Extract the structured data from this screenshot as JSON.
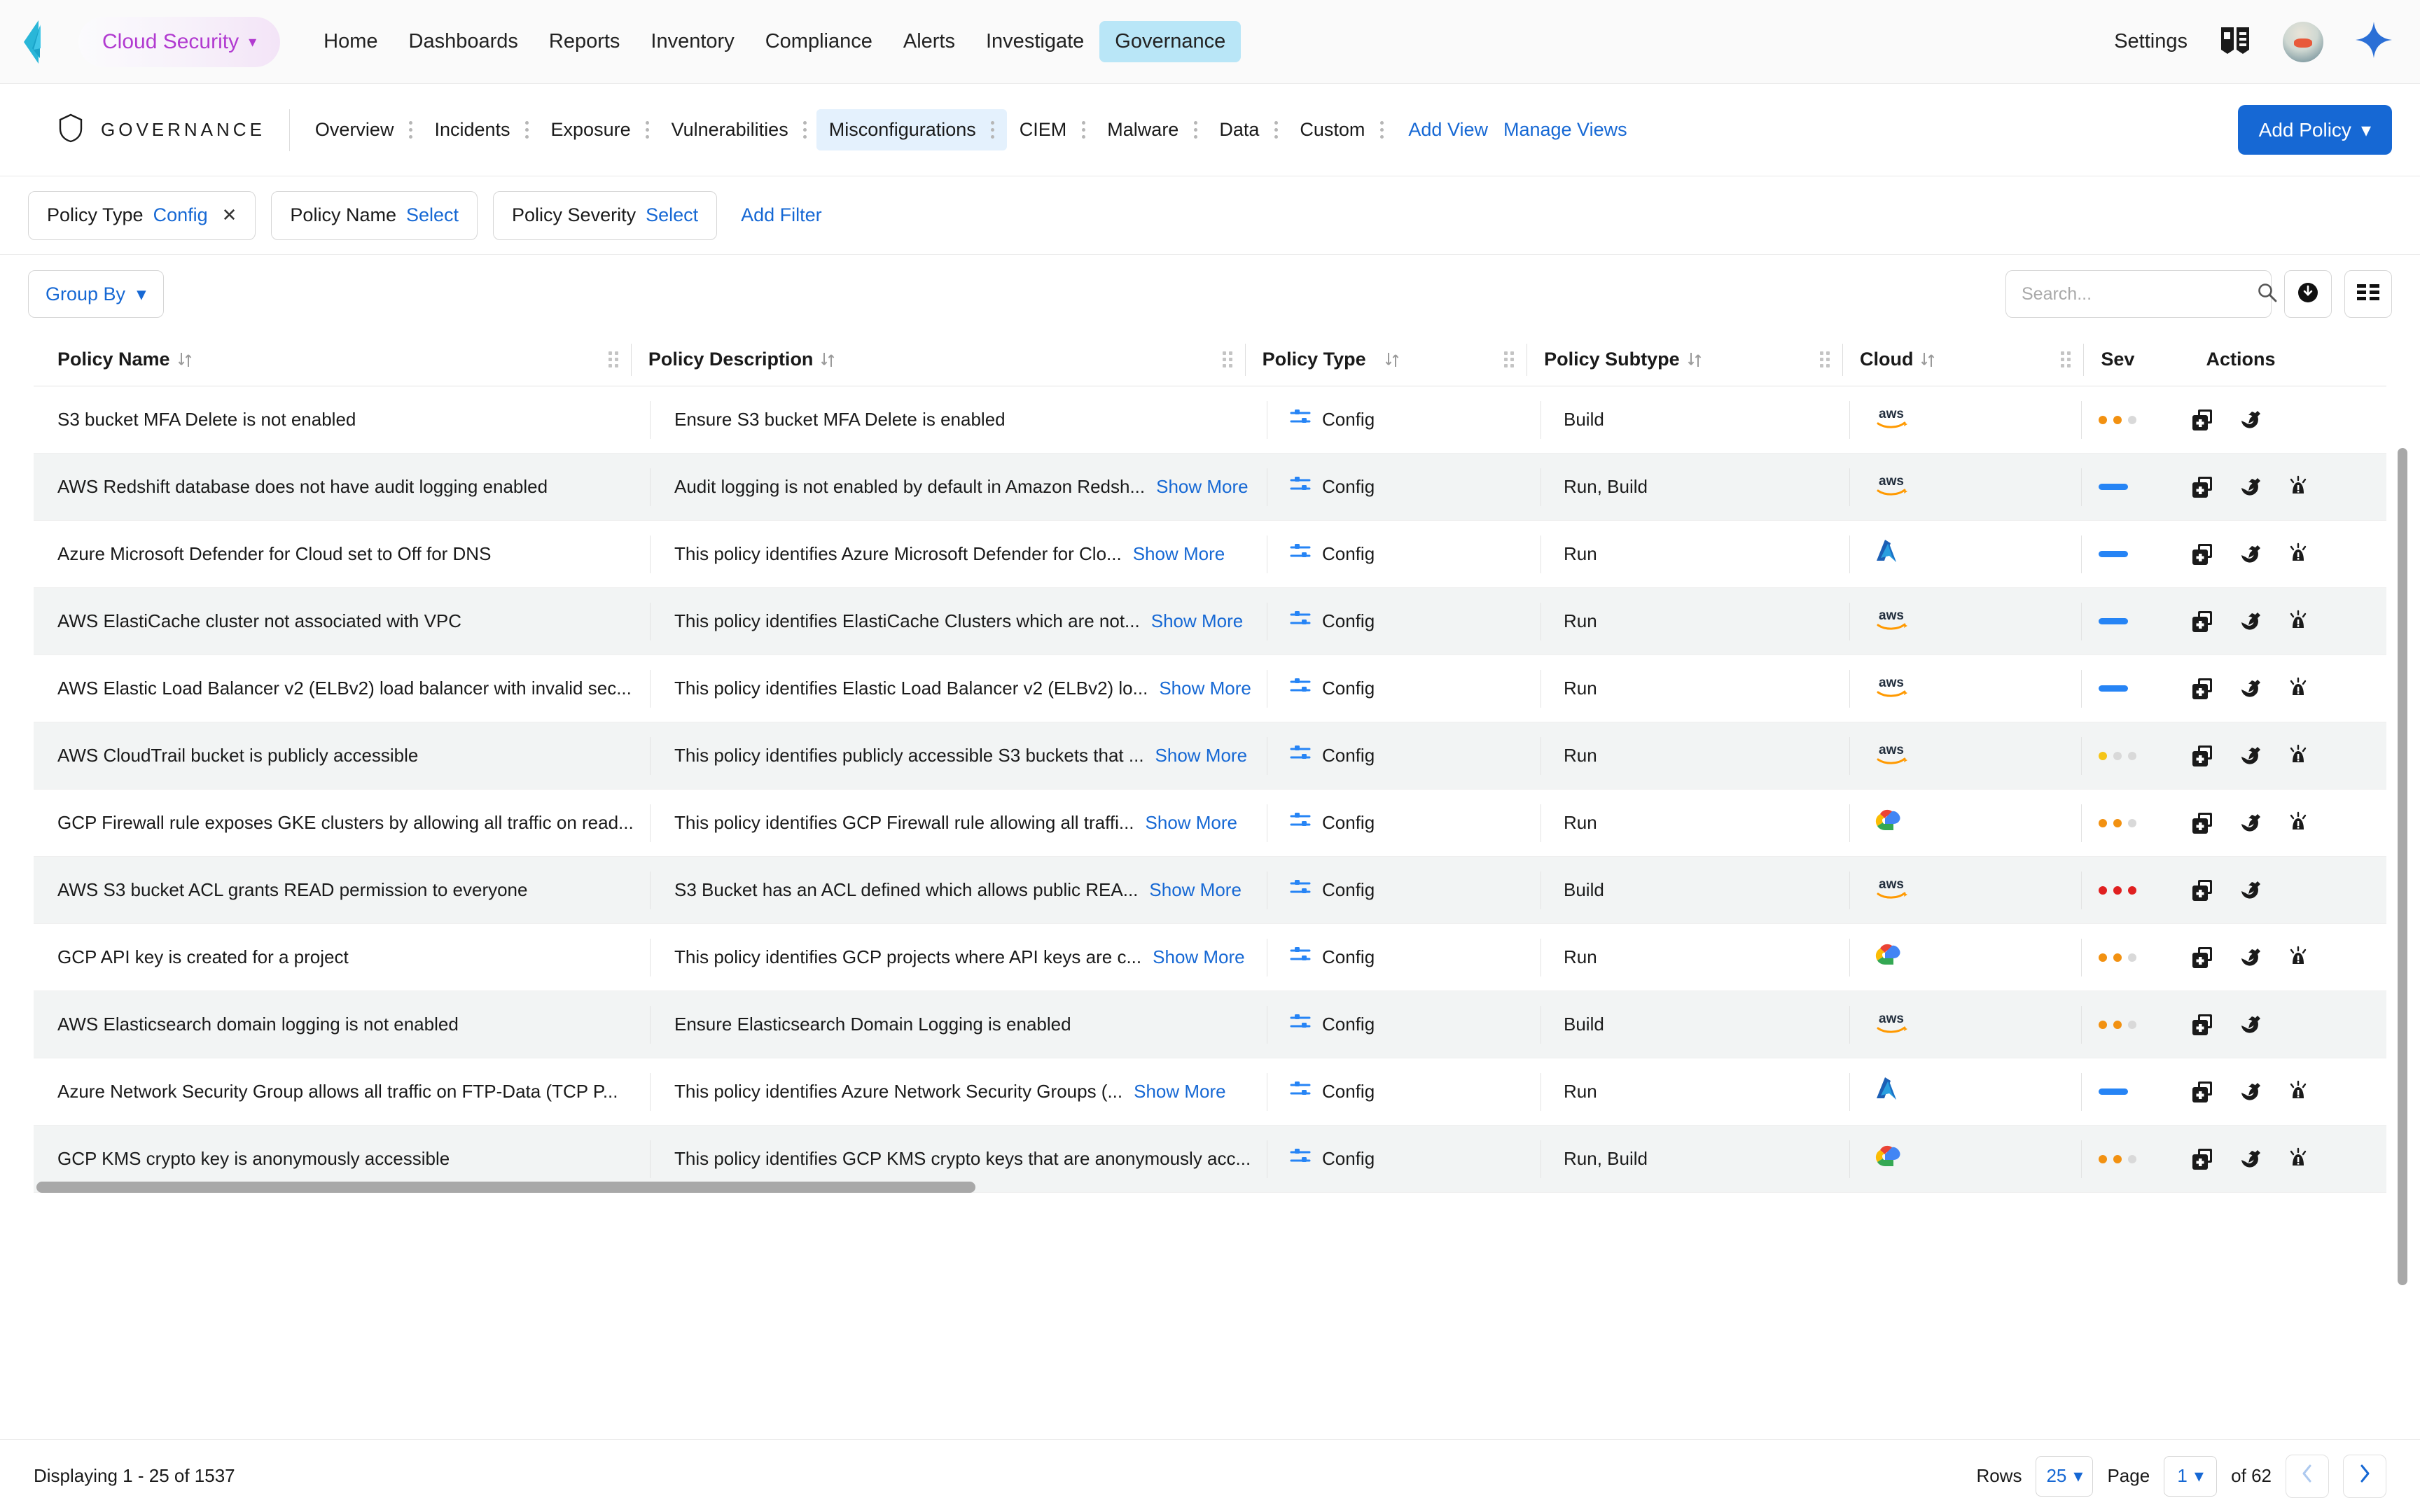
{
  "topnav": {
    "app_switcher": {
      "label": "Cloud Security",
      "caret": "chevron-down-icon"
    },
    "menu": [
      {
        "label": "Home",
        "active": false
      },
      {
        "label": "Dashboards",
        "active": false
      },
      {
        "label": "Reports",
        "active": false
      },
      {
        "label": "Inventory",
        "active": false
      },
      {
        "label": "Compliance",
        "active": false
      },
      {
        "label": "Alerts",
        "active": false
      },
      {
        "label": "Investigate",
        "active": false
      },
      {
        "label": "Governance",
        "active": true
      }
    ],
    "settings_label": "Settings",
    "icons": {
      "docs": "book-icon",
      "avatar": "user-avatar",
      "assistant": "sparkle-icon"
    },
    "colors": {
      "active_tab_bg": "#b9e6f7",
      "brand_purple": "#b13ad0"
    }
  },
  "subnav": {
    "section_icon": "shield-icon",
    "section_title": "GOVERNANCE",
    "tabs": [
      {
        "label": "Overview",
        "active": false
      },
      {
        "label": "Incidents",
        "active": false
      },
      {
        "label": "Exposure",
        "active": false
      },
      {
        "label": "Vulnerabilities",
        "active": false
      },
      {
        "label": "Misconfigurations",
        "active": true
      },
      {
        "label": "CIEM",
        "active": false
      },
      {
        "label": "Malware",
        "active": false
      },
      {
        "label": "Data",
        "active": false
      },
      {
        "label": "Custom",
        "active": false
      }
    ],
    "add_view": "Add View",
    "manage_views": "Manage Views",
    "add_policy": "Add Policy",
    "colors": {
      "active_tab_bg": "#e4f1fd",
      "primary": "#1668d4"
    }
  },
  "filters": {
    "chips": [
      {
        "label": "Policy Type",
        "value": "Config",
        "removable": true
      },
      {
        "label": "Policy Name",
        "value": "Select",
        "removable": false
      },
      {
        "label": "Policy Severity",
        "value": "Select",
        "removable": false
      }
    ],
    "add_filter": "Add Filter"
  },
  "toolbar": {
    "group_by": "Group By",
    "search_placeholder": "Search...",
    "search_value": "",
    "icons": {
      "search": "search-icon",
      "clear": "close-icon",
      "download": "download-icon",
      "columns": "column-settings-icon"
    }
  },
  "table": {
    "columns": [
      {
        "key": "policy_name",
        "label": "Policy Name",
        "sortable": true
      },
      {
        "key": "policy_description",
        "label": "Policy Description",
        "sortable": true
      },
      {
        "key": "policy_type",
        "label": "Policy Type",
        "sortable": true
      },
      {
        "key": "policy_subtype",
        "label": "Policy Subtype",
        "sortable": true
      },
      {
        "key": "cloud",
        "label": "Cloud",
        "sortable": true
      },
      {
        "key": "severity",
        "label": "Sev",
        "sortable": false
      },
      {
        "key": "actions",
        "label": "Actions",
        "sortable": false
      }
    ],
    "show_more_label": "Show More",
    "rows": [
      {
        "policy_name": "S3 bucket MFA Delete is not enabled",
        "policy_description": "Ensure S3 bucket MFA Delete is enabled",
        "show_more": false,
        "policy_type": "Config",
        "policy_subtype": "Build",
        "cloud": "aws",
        "severity": "medium",
        "actions": [
          "duplicate-icon",
          "edit-icon"
        ]
      },
      {
        "policy_name": "AWS Redshift database does not have audit logging enabled",
        "policy_description": "Audit logging is not enabled by default in Amazon Redsh...",
        "show_more": true,
        "policy_type": "Config",
        "policy_subtype": "Run, Build",
        "cloud": "aws",
        "severity": "informational",
        "actions": [
          "duplicate-icon",
          "edit-icon",
          "alert-icon"
        ]
      },
      {
        "policy_name": "Azure Microsoft Defender for Cloud set to Off for DNS",
        "policy_description": "This policy identifies Azure Microsoft Defender for Clo...",
        "show_more": true,
        "policy_type": "Config",
        "policy_subtype": "Run",
        "cloud": "azure",
        "severity": "informational",
        "actions": [
          "duplicate-icon",
          "edit-icon",
          "alert-icon"
        ]
      },
      {
        "policy_name": "AWS ElastiCache cluster not associated with VPC",
        "policy_description": "This policy identifies ElastiCache Clusters which are not...",
        "show_more": true,
        "policy_type": "Config",
        "policy_subtype": "Run",
        "cloud": "aws",
        "severity": "informational",
        "actions": [
          "duplicate-icon",
          "edit-icon",
          "alert-icon"
        ]
      },
      {
        "policy_name": "AWS Elastic Load Balancer v2 (ELBv2) load balancer with invalid sec...",
        "policy_description": "This policy identifies Elastic Load Balancer v2 (ELBv2) lo...",
        "show_more": true,
        "policy_type": "Config",
        "policy_subtype": "Run",
        "cloud": "aws",
        "severity": "informational",
        "actions": [
          "duplicate-icon",
          "edit-icon",
          "alert-icon"
        ]
      },
      {
        "policy_name": "AWS CloudTrail bucket is publicly accessible",
        "policy_description": "This policy identifies publicly accessible S3 buckets that ...",
        "show_more": true,
        "policy_type": "Config",
        "policy_subtype": "Run",
        "cloud": "aws",
        "severity": "low",
        "actions": [
          "duplicate-icon",
          "edit-icon",
          "alert-icon"
        ]
      },
      {
        "policy_name": "GCP Firewall rule exposes GKE clusters by allowing all traffic on read...",
        "policy_description": "This policy identifies GCP Firewall rule allowing all traffi...",
        "show_more": true,
        "policy_type": "Config",
        "policy_subtype": "Run",
        "cloud": "gcp",
        "severity": "medium",
        "actions": [
          "duplicate-icon",
          "edit-icon",
          "alert-icon"
        ]
      },
      {
        "policy_name": "AWS S3 bucket ACL grants READ permission to everyone",
        "policy_description": "S3 Bucket has an ACL defined which allows public REA...",
        "show_more": true,
        "policy_type": "Config",
        "policy_subtype": "Build",
        "cloud": "aws",
        "severity": "high",
        "actions": [
          "duplicate-icon",
          "edit-icon"
        ]
      },
      {
        "policy_name": "GCP API key is created for a project",
        "policy_description": "This policy identifies GCP projects where API keys are c...",
        "show_more": true,
        "policy_type": "Config",
        "policy_subtype": "Run",
        "cloud": "gcp",
        "severity": "medium",
        "actions": [
          "duplicate-icon",
          "edit-icon",
          "alert-icon"
        ]
      },
      {
        "policy_name": "AWS Elasticsearch domain logging is not enabled",
        "policy_description": "Ensure Elasticsearch Domain Logging is enabled",
        "show_more": false,
        "policy_type": "Config",
        "policy_subtype": "Build",
        "cloud": "aws",
        "severity": "medium",
        "actions": [
          "duplicate-icon",
          "edit-icon"
        ]
      },
      {
        "policy_name": "Azure Network Security Group allows all traffic on FTP-Data (TCP P...",
        "policy_description": "This policy identifies Azure Network Security Groups (...",
        "show_more": true,
        "policy_type": "Config",
        "policy_subtype": "Run",
        "cloud": "azure",
        "severity": "informational",
        "actions": [
          "duplicate-icon",
          "edit-icon",
          "alert-icon"
        ]
      },
      {
        "policy_name": "GCP KMS crypto key is anonymously accessible",
        "policy_description": "This policy identifies GCP KMS crypto keys that are anonymously acc...",
        "show_more": false,
        "policy_type": "Config",
        "policy_subtype": "Run, Build",
        "cloud": "gcp",
        "severity": "medium",
        "actions": [
          "duplicate-icon",
          "edit-icon",
          "alert-icon"
        ]
      }
    ]
  },
  "footer": {
    "displaying": "Displaying 1 - 25 of 1537",
    "rows_label": "Rows",
    "rows_value": "25",
    "page_label": "Page",
    "page_value": "1",
    "of_label": "of 62",
    "prev_icon": "chevron-left-icon",
    "next_icon": "chevron-right-icon"
  },
  "severity_colors": {
    "informational": "#2684f5",
    "low": "#f5c518",
    "medium": "#f29111",
    "high": "#e02020",
    "empty": "#d9d9d9"
  }
}
